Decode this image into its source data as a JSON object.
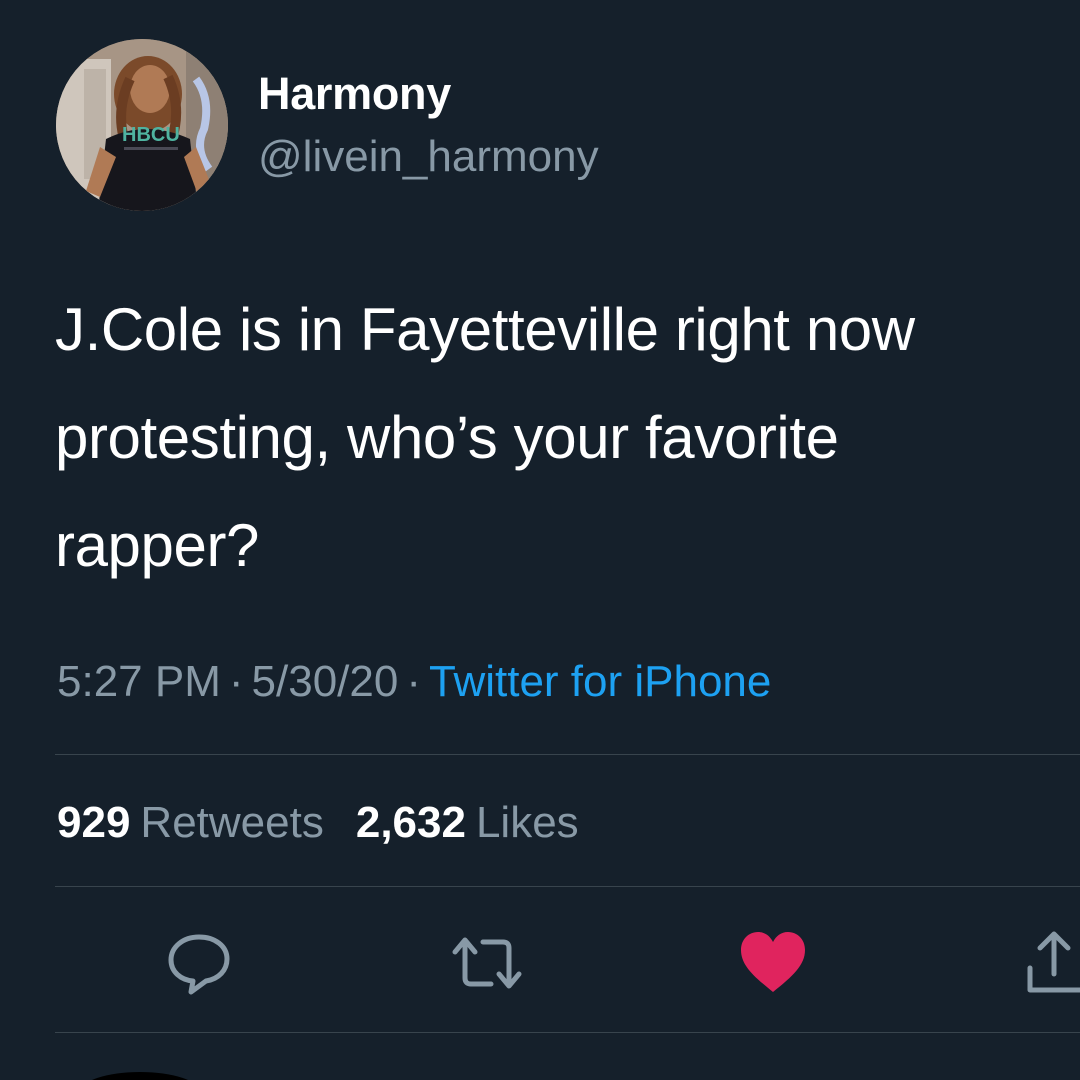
{
  "tweet": {
    "author": {
      "display_name": "Harmony",
      "handle": "@livein_harmony",
      "avatar_shirt_text": "HBCU"
    },
    "text_lines": [
      "J.Cole is in Fayetteville right now",
      "protesting, who’s your favorite",
      "rapper?"
    ],
    "meta": {
      "time": "5:27 PM",
      "separator": "·",
      "date": "5/30/20",
      "source": "Twitter for iPhone"
    },
    "stats": {
      "retweets_count": "929",
      "retweets_label": "Retweets",
      "likes_count": "2,632",
      "likes_label": "Likes"
    },
    "actions": {
      "reply_icon": "reply-icon",
      "retweet_icon": "retweet-icon",
      "like_icon": "heart-icon",
      "share_icon": "share-icon",
      "liked": true
    }
  },
  "colors": {
    "background": "#15202b",
    "primary_text": "#ffffff",
    "secondary_text": "#8899a6",
    "link": "#1da1f2",
    "like": "#e0245e",
    "divider": "#38444d"
  }
}
